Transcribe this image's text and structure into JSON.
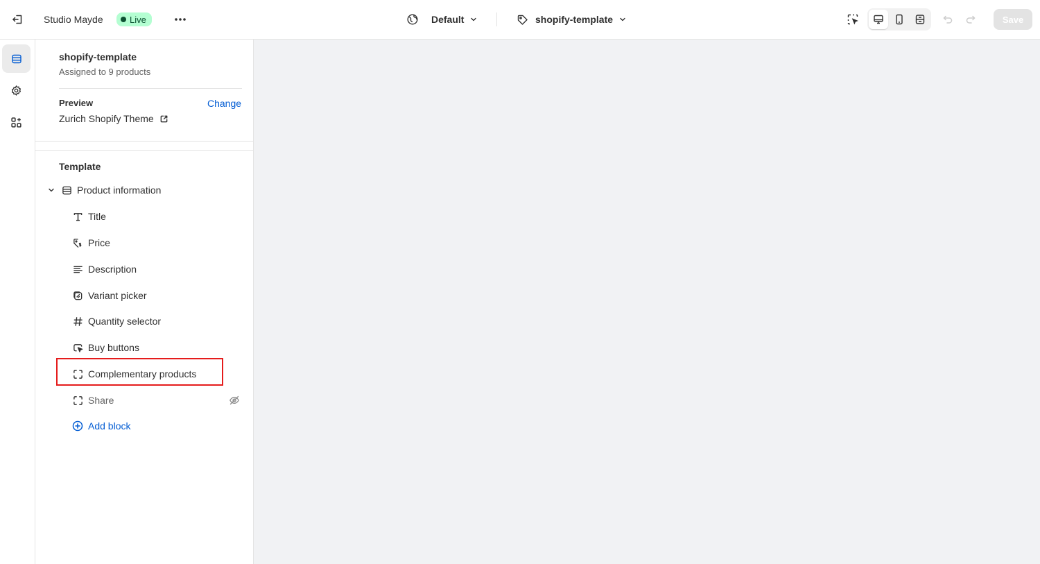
{
  "topbar": {
    "store_name": "Studio Mayde",
    "live_badge": "Live",
    "theme_selector": "Default",
    "template_selector": "shopify-template",
    "save_label": "Save"
  },
  "panel": {
    "template_name": "shopify-template",
    "assigned": "Assigned to 9 products",
    "preview_label": "Preview",
    "change_link": "Change",
    "preview_value": "Zurich Shopify Theme",
    "template_heading": "Template",
    "section": {
      "label": "Product information",
      "icon": "section-icon"
    },
    "blocks": [
      {
        "label": "Title",
        "icon": "text-icon",
        "hidden": false
      },
      {
        "label": "Price",
        "icon": "price-tag-icon",
        "hidden": false
      },
      {
        "label": "Description",
        "icon": "text-align-icon",
        "hidden": false
      },
      {
        "label": "Variant picker",
        "icon": "variant-icon",
        "hidden": false
      },
      {
        "label": "Quantity selector",
        "icon": "hashtag-icon",
        "hidden": false
      },
      {
        "label": "Buy buttons",
        "icon": "cursor-icon",
        "hidden": false
      },
      {
        "label": "Complementary products",
        "icon": "block-icon",
        "hidden": false
      },
      {
        "label": "Share",
        "icon": "block-icon",
        "hidden": true
      }
    ],
    "add_block": "Add block"
  },
  "colors": {
    "accent": "#005bd3",
    "live_bg": "#b4fed2",
    "live_text": "#0c5132",
    "highlight": "#e51c1c",
    "canvas_bg": "#f1f2f4"
  }
}
